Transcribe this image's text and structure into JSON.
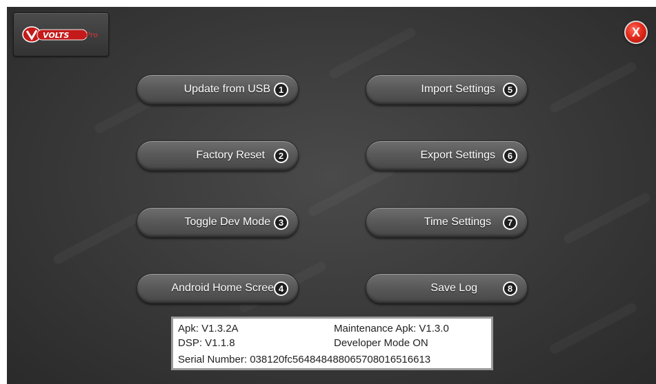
{
  "header": {
    "logo_icon": "volts-pro-logo",
    "logo_text": "VOLTS",
    "logo_suffix": "Pro",
    "close_label": "X"
  },
  "buttons": [
    {
      "label": "Update from USB",
      "num": "1"
    },
    {
      "label": "Factory Reset",
      "num": "2"
    },
    {
      "label": "Toggle Dev Mode",
      "num": "3"
    },
    {
      "label": "Android Home Scree",
      "num": "4"
    },
    {
      "label": "Import Settings",
      "num": "5"
    },
    {
      "label": "Export Settings",
      "num": "6"
    },
    {
      "label": "Time Settings",
      "num": "7"
    },
    {
      "label": "Save Log",
      "num": "8"
    }
  ],
  "info": {
    "apk": "Apk: V1.3.2A",
    "maintenance_apk": "Maintenance Apk: V1.3.0",
    "dsp": "DSP: V1.1.8",
    "developer_mode": "Developer Mode ON",
    "serial": "Serial Number: 038120fc5648484880657080165166​13"
  },
  "colors": {
    "background": "#3a3a3a",
    "button": "#5a5a5a",
    "close_red": "#e42a1c",
    "logo_red": "#c41a1a"
  }
}
